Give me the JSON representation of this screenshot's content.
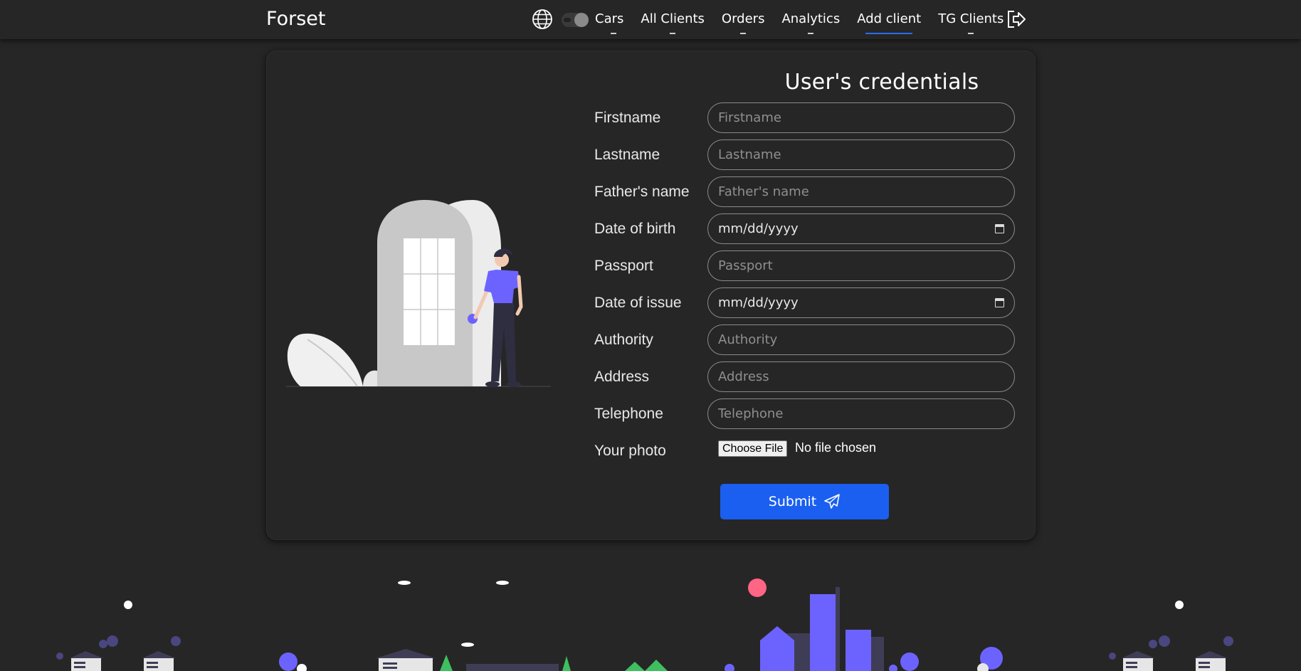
{
  "nav": {
    "brand": "Forset",
    "items": [
      {
        "label": "Cars"
      },
      {
        "label": "All Clients"
      },
      {
        "label": "Orders"
      },
      {
        "label": "Analytics"
      },
      {
        "label": "Add client",
        "active": true
      },
      {
        "label": "TG Clients"
      }
    ]
  },
  "form": {
    "title": "User's credentials",
    "firstname": {
      "label": "Firstname",
      "placeholder": "Firstname"
    },
    "lastname": {
      "label": "Lastname",
      "placeholder": "Lastname"
    },
    "father_name": {
      "label": "Father's name",
      "placeholder": "Father's name"
    },
    "date_of_birth": {
      "label": "Date of birth",
      "value": "mm/dd/yyyy"
    },
    "passport": {
      "label": "Passport",
      "placeholder": "Passport"
    },
    "date_of_issue": {
      "label": "Date of issue",
      "value": "mm/dd/yyyy"
    },
    "authority": {
      "label": "Authority",
      "placeholder": "Authority"
    },
    "address": {
      "label": "Address",
      "placeholder": "Address"
    },
    "telephone": {
      "label": "Telephone",
      "placeholder": "Telephone"
    },
    "photo": {
      "label": "Your photo",
      "button": "Choose File",
      "status": "No file chosen"
    },
    "submit_label": "Submit"
  },
  "colors": {
    "background": "#262626",
    "accent": "#1a5ff0",
    "illustration_purple": "#6c63ff",
    "field_border": "#8a8a8a"
  },
  "icons": {
    "globe": "globe-icon",
    "theme_toggle": "theme-toggle",
    "logout": "logout-icon",
    "submit": "paper-plane-icon",
    "calendar": "calendar-icon"
  }
}
